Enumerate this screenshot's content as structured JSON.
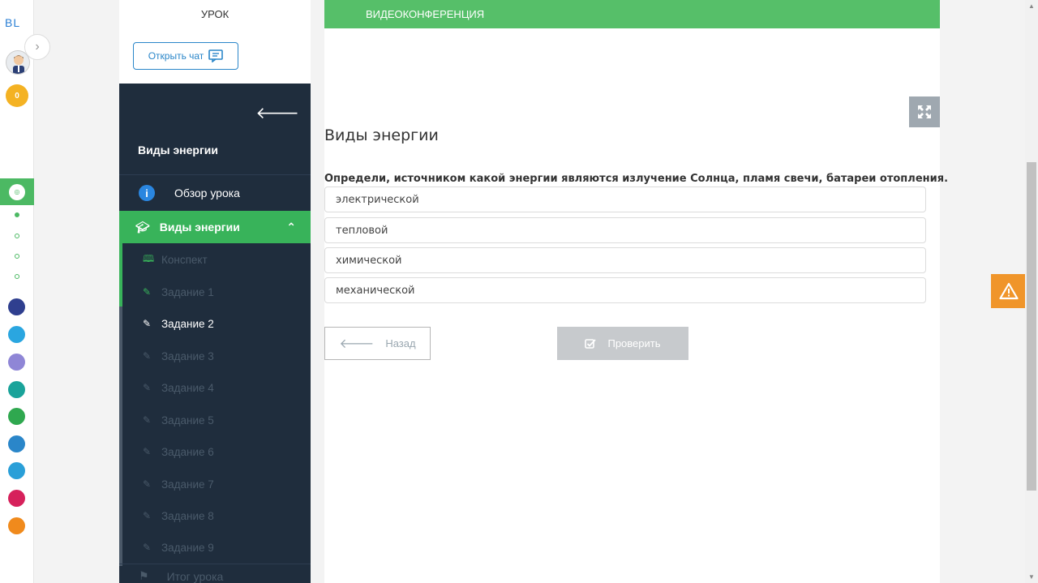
{
  "rail": {
    "logo": "BL",
    "coins": "0",
    "apps": [
      {
        "name": "smart",
        "color": "#2f3f8f"
      },
      {
        "name": "help",
        "color": "#2aa6e0"
      },
      {
        "name": "grid",
        "color": "#8f86d6"
      },
      {
        "name": "app-teal",
        "color": "#1aa39a"
      },
      {
        "name": "app-green",
        "color": "#2fa84f"
      },
      {
        "name": "app-blue",
        "color": "#2a86c9"
      },
      {
        "name": "app-check",
        "color": "#2a9fd8"
      },
      {
        "name": "twig",
        "color": "#d6215b"
      },
      {
        "name": "app-orange",
        "color": "#f08a1c"
      }
    ]
  },
  "tabs": {
    "lesson": "УРОК",
    "video": "ВИДЕОКОНФЕРЕНЦИЯ"
  },
  "chat_button": "Открыть чат",
  "nav": {
    "title": "Виды энергии",
    "overview": "Обзор урока",
    "section": "Виды энергии",
    "items": [
      {
        "label": "Конспект",
        "icon": "book-icon",
        "state": "done"
      },
      {
        "label": "Задание 1",
        "icon": "edit-icon",
        "state": "done"
      },
      {
        "label": "Задание 2",
        "icon": "edit-icon",
        "state": "current"
      },
      {
        "label": "Задание 3",
        "icon": "edit-icon",
        "state": "locked"
      },
      {
        "label": "Задание 4",
        "icon": "edit-icon",
        "state": "locked"
      },
      {
        "label": "Задание 5",
        "icon": "edit-icon",
        "state": "locked"
      },
      {
        "label": "Задание 6",
        "icon": "edit-icon",
        "state": "locked"
      },
      {
        "label": "Задание 7",
        "icon": "edit-icon",
        "state": "locked"
      },
      {
        "label": "Задание 8",
        "icon": "edit-icon",
        "state": "locked"
      },
      {
        "label": "Задание 9",
        "icon": "edit-icon",
        "state": "locked"
      }
    ],
    "summary": "Итог урока"
  },
  "task": {
    "title": "Виды энергии",
    "question": "Определи, источником какой энергии являются излучение Солнца, пламя свечи, батареи отопления.",
    "options": [
      "электрической",
      "тепловой",
      "химической",
      "механической"
    ]
  },
  "buttons": {
    "back": "Назад",
    "check": "Проверить"
  },
  "colors": {
    "accent_green": "#56bf69",
    "nav_bg": "#1f2d3d",
    "warning": "#f0952a"
  }
}
